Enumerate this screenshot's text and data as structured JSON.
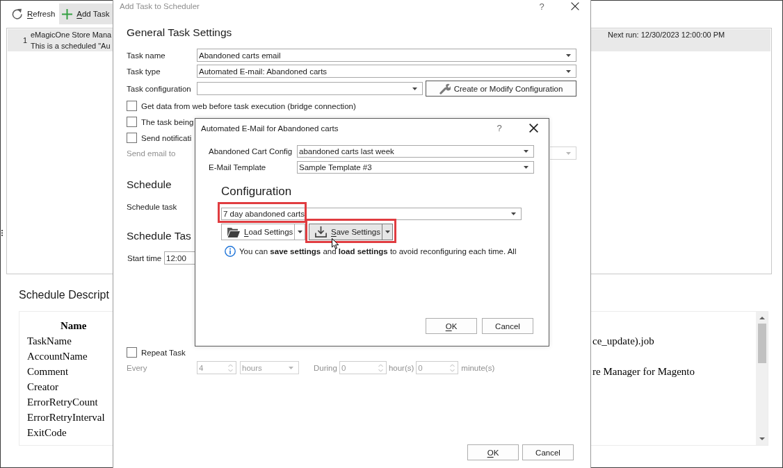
{
  "main_window": {
    "toolbar": [
      {
        "kind": "refresh",
        "label": "Refresh",
        "access_key": true,
        "highlighted": false
      },
      {
        "kind": "add",
        "label": "Add Task",
        "access_key": true,
        "highlighted": true
      }
    ],
    "task_list": [
      {
        "number": "1",
        "title": "eMagicOne Store Mana",
        "description": "This is a scheduled \"Au",
        "next_run": "Next run: 12/30/2023 12:00:00 PM",
        "selected": true
      }
    ],
    "schedule_description": {
      "heading": "Schedule Descript",
      "table": {
        "columns": [
          "Name"
        ],
        "rows": [
          {
            "name": "TaskName",
            "column_2": "ce_update).job"
          },
          {
            "name": "AccountName"
          },
          {
            "name": "Comment",
            "column_2": "re Manager for Magento"
          },
          {
            "name": "Creator"
          },
          {
            "name": "ErrorRetryCount"
          },
          {
            "name": "ErrorRetryInterval"
          },
          {
            "name": "ExitCode"
          }
        ]
      }
    }
  },
  "task_dialog": {
    "title": "Add Task to Scheduler",
    "active": false,
    "help": "?",
    "general_heading": "General Task Settings",
    "fields": [
      {
        "kind": "combo",
        "label": "Task name",
        "value": "Abandoned carts email"
      },
      {
        "kind": "combo",
        "label": "Task type",
        "value": "Automated E-mail: Abandoned carts"
      },
      {
        "kind": "combo_button",
        "label": "Task configuration",
        "button": "Create or Modify Configuration"
      }
    ],
    "checkboxes": [
      {
        "label": "Get data from web before task execution (bridge connection)",
        "checked": false
      },
      {
        "label": "The task being",
        "checked": false
      },
      {
        "label": "Send notificati",
        "checked": false
      }
    ],
    "send_email": {
      "label": "Send email to",
      "disabled": true
    },
    "schedule_heading": "Schedule",
    "schedule_task_label": "Schedule task",
    "schedule_time_heading": "Schedule Tas",
    "start_time": {
      "label": "Start time",
      "value": "12:00"
    },
    "repeat_task": {
      "label": "Repeat Task",
      "checked": false
    },
    "repeat_every": {
      "disabled": true,
      "label": "Every",
      "interval": "4",
      "unit": "hours",
      "during_label": "During",
      "hours": "0",
      "hours_label": "hour(s)",
      "minutes": "0",
      "minutes_label": "minute(s)"
    },
    "buttons": [
      {
        "label": "OK",
        "access_key": true
      },
      {
        "label": "Cancel",
        "access_key": false
      }
    ]
  },
  "config_dialog": {
    "title": "Automated E-Mail for Abandoned carts",
    "active": true,
    "help": "?",
    "fields": [
      {
        "label": "Abandoned Cart Config",
        "value": "abandoned carts last week"
      },
      {
        "label": "E-Mail Template",
        "value": "Sample Template #3"
      }
    ],
    "configuration": {
      "heading": "Configuration",
      "value": "7 day abandoned carts",
      "highlighted": true
    },
    "split_buttons": [
      {
        "kind": "load",
        "label": "Load Settings",
        "access_key": true,
        "highlighted": false
      },
      {
        "kind": "save",
        "label": "Save Settings",
        "access_key": true,
        "highlighted": true
      }
    ],
    "info": "You can **save settings** and **load settings** to avoid reconfiguring each time. All",
    "buttons": [
      {
        "label": "OK",
        "access_key": true
      },
      {
        "label": "Cancel",
        "access_key": false
      }
    ]
  }
}
